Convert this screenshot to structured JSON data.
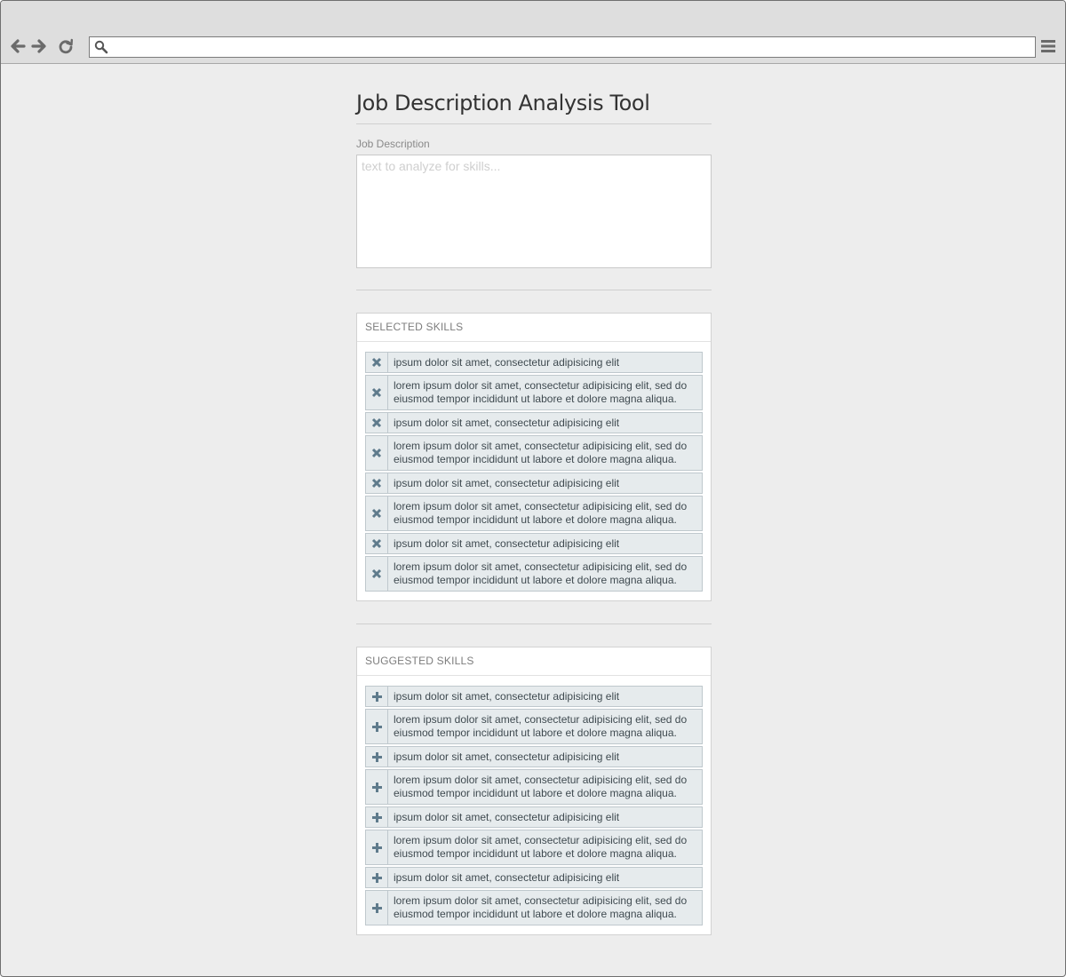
{
  "browser": {
    "address_value": "",
    "icons": [
      "back-arrow-icon",
      "forward-arrow-icon",
      "reload-icon",
      "search-icon",
      "hamburger-menu-icon"
    ]
  },
  "page": {
    "title": "Job Description Analysis Tool",
    "job_description": {
      "label": "Job Description",
      "placeholder": "text to analyze for skills...",
      "value": ""
    }
  },
  "selected_skills": {
    "heading": "SELECTED SKILLS",
    "action_icon": "remove-x-icon",
    "items": [
      {
        "text": "ipsum dolor sit amet, consectetur adipisicing elit"
      },
      {
        "text": "lorem ipsum dolor sit amet, consectetur adipisicing elit, sed do eiusmod tempor incididunt ut labore et dolore magna aliqua."
      },
      {
        "text": "ipsum dolor sit amet, consectetur adipisicing elit"
      },
      {
        "text": "lorem ipsum dolor sit amet, consectetur adipisicing elit, sed do eiusmod tempor incididunt ut labore et dolore magna aliqua."
      },
      {
        "text": "ipsum dolor sit amet, consectetur adipisicing elit"
      },
      {
        "text": "lorem ipsum dolor sit amet, consectetur adipisicing elit, sed do eiusmod tempor incididunt ut labore et dolore magna aliqua."
      },
      {
        "text": "ipsum dolor sit amet, consectetur adipisicing elit"
      },
      {
        "text": "lorem ipsum dolor sit amet, consectetur adipisicing elit, sed do eiusmod tempor incididunt ut labore et dolore magna aliqua."
      }
    ]
  },
  "suggested_skills": {
    "heading": "SUGGESTED SKILLS",
    "action_icon": "add-plus-icon",
    "items": [
      {
        "text": "ipsum dolor sit amet, consectetur adipisicing elit"
      },
      {
        "text": "lorem ipsum dolor sit amet, consectetur adipisicing elit, sed do eiusmod tempor incididunt ut labore et dolore magna aliqua."
      },
      {
        "text": "ipsum dolor sit amet, consectetur adipisicing elit"
      },
      {
        "text": "lorem ipsum dolor sit amet, consectetur adipisicing elit, sed do eiusmod tempor incididunt ut labore et dolore magna aliqua."
      },
      {
        "text": "ipsum dolor sit amet, consectetur adipisicing elit"
      },
      {
        "text": "lorem ipsum dolor sit amet, consectetur adipisicing elit, sed do eiusmod tempor incididunt ut labore et dolore magna aliqua."
      },
      {
        "text": "ipsum dolor sit amet, consectetur adipisicing elit"
      },
      {
        "text": "lorem ipsum dolor sit amet, consectetur adipisicing elit, sed do eiusmod tempor incididunt ut labore et dolore magna aliqua."
      }
    ]
  },
  "colors": {
    "page_background": "#ededed",
    "chrome": "#dedede",
    "skill_row_background": "#e6ebed",
    "skill_row_border": "#bfc8cd",
    "skill_icon": "#5f7b8c",
    "title_text": "#333333"
  }
}
